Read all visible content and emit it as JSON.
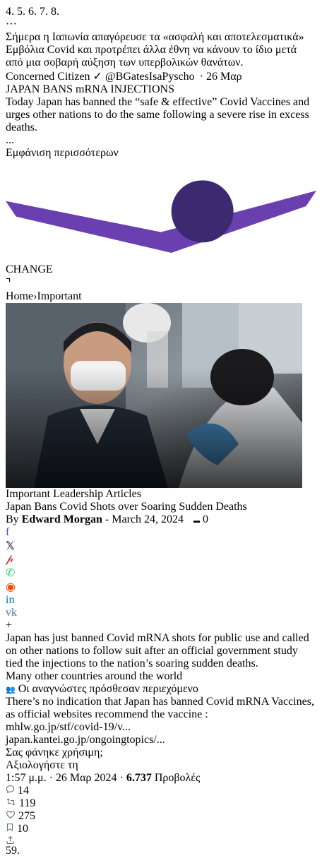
{
  "header": {
    "more_label": "···"
  },
  "tweet": {
    "text": "Σήμερα η Ιαπωνία απαγόρευσε τα «ασφαλή και αποτελεσματικά» Εμβόλια Covid και προτρέπει άλλα έθνη να κάνουν το ίδιο μετά από μια σοβαρή αύξηση των υπερβολικών θανάτων."
  },
  "quoted": {
    "name": "Concerned Citizen",
    "handle": "@BGatesIsaPyscho",
    "date": "· 26 Μαρ",
    "headline": "JAPAN BANS mRNA INJECTIONS",
    "text": "Today Japan has banned the “safe & effective” Covid Vaccines and urges other nations to do the same following a severe rise in excess deaths.",
    "ellipsis": "...",
    "show_more": "Εμφάνιση περισσότερων"
  },
  "article": {
    "site_logo_text": "CHANGE",
    "breadcrumb": [
      "Home",
      "›",
      "Important"
    ],
    "tags": [
      "Important",
      "Leadership Articles"
    ],
    "title": "Japan Bans Covid Shots over Soaring Sudden Deaths",
    "byline_prefix": "By",
    "author": "Edward Morgan",
    "separator": "-",
    "date": "March 24, 2024",
    "comments": "0",
    "body": "Japan has just banned Covid mRNA shots for public use and called on other nations to follow suit after an official government study tied the injections to the nation’s soaring sudden deaths.",
    "cut_text": "Many other countries around the world"
  },
  "share_buttons": [
    {
      "icon": "facebook-icon",
      "glyph": "f",
      "color": "#3b5998"
    },
    {
      "icon": "x-icon",
      "glyph": "𝕏",
      "color": "#000000"
    },
    {
      "icon": "pinterest-icon",
      "glyph": "𝓅",
      "color": "#cb2027"
    },
    {
      "icon": "whatsapp-icon",
      "glyph": "✆",
      "color": "#25d366"
    },
    {
      "icon": "reddit-icon",
      "glyph": "◉",
      "color": "#ff4500"
    },
    {
      "icon": "linkedin-icon",
      "glyph": "in",
      "color": "#0077b5"
    },
    {
      "icon": "vk-icon",
      "glyph": "vk",
      "color": "#4c75a3"
    },
    {
      "icon": "plus-icon",
      "glyph": "+",
      "color": "#111111"
    }
  ],
  "community_note": {
    "header": "Οι αναγνώστες πρόσθεσαν περιεχόμενο",
    "body": "There’s no indication that Japan has banned Covid mRNA Vaccines, as official websites recommend the vaccine :",
    "link1": "mhlw.go.jp/stf/covid-19/v...",
    "link2": "japan.kantei.go.jp/ongoingtopics/...",
    "question": "Σας φάνηκε χρήσιμη;",
    "rate_button": "Αξιολογήστε τη"
  },
  "footer": {
    "time": "1:57 μ.μ. · 26 Μαρ 2024 ·",
    "views_count": "6.737",
    "views_label": "Προβολές",
    "replies": "14",
    "reposts": "119",
    "likes": "275",
    "bookmarks": "10"
  },
  "colors": {
    "accent": "#1d9bf0",
    "highlight_box": "#e00000",
    "brand_purple": "#7b3fc4"
  }
}
